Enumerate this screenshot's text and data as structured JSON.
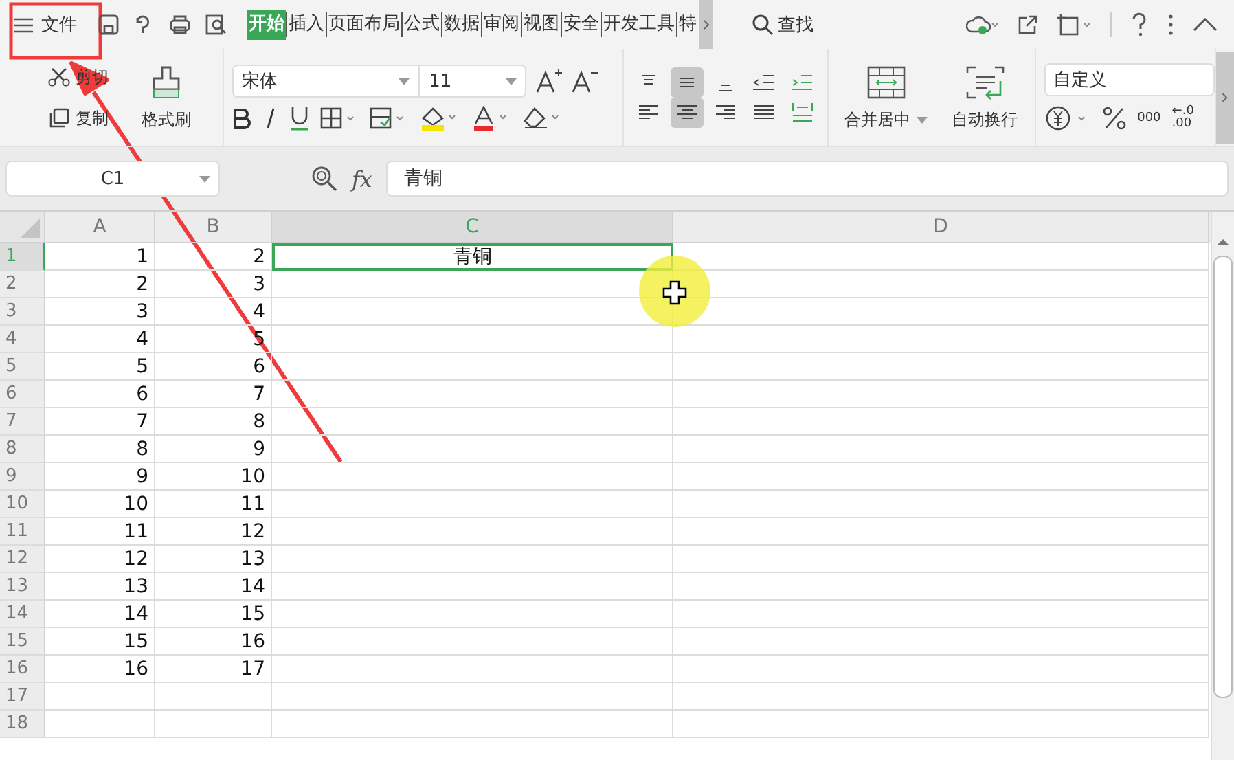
{
  "menu": {
    "label": "文件"
  },
  "tabs": [
    {
      "label": "开始",
      "selected": true
    },
    {
      "label": "插入",
      "selected": false
    },
    {
      "label": "页面布局",
      "selected": false
    },
    {
      "label": "公式",
      "selected": false
    },
    {
      "label": "数据",
      "selected": false
    },
    {
      "label": "审阅",
      "selected": false
    },
    {
      "label": "视图",
      "selected": false
    },
    {
      "label": "安全",
      "selected": false
    },
    {
      "label": "开发工具",
      "selected": false
    },
    {
      "label": "特",
      "selected": false
    }
  ],
  "search": {
    "label": "查找"
  },
  "clipboard": {
    "cut": "剪切",
    "copy": "复制",
    "format_painter": "格式刷"
  },
  "font": {
    "family": "宋体",
    "size": "11"
  },
  "merge": {
    "label": "合并居中"
  },
  "wrap": {
    "label": "自动换行"
  },
  "number_format": {
    "value": "自定义",
    "thousands": "000",
    "decimal_top": "←.0",
    "decimal_bottom": ".00"
  },
  "align": {
    "top_selected": false,
    "middle_selected": true,
    "center_selected": true
  },
  "formula_bar": {
    "name_box": "C1",
    "fx": "fx",
    "value": "青铜"
  },
  "sheet": {
    "columns": [
      {
        "label": "A",
        "selected": false
      },
      {
        "label": "B",
        "selected": false
      },
      {
        "label": "C",
        "selected": true
      },
      {
        "label": "D",
        "selected": false
      }
    ],
    "rows": [
      {
        "label": "1",
        "selected": true,
        "cells": [
          "1",
          "2",
          "青铜"
        ]
      },
      {
        "label": "2",
        "selected": false,
        "cells": [
          "2",
          "3",
          ""
        ]
      },
      {
        "label": "3",
        "selected": false,
        "cells": [
          "3",
          "4",
          ""
        ]
      },
      {
        "label": "4",
        "selected": false,
        "cells": [
          "4",
          "5",
          ""
        ]
      },
      {
        "label": "5",
        "selected": false,
        "cells": [
          "5",
          "6",
          ""
        ]
      },
      {
        "label": "6",
        "selected": false,
        "cells": [
          "6",
          "7",
          ""
        ]
      },
      {
        "label": "7",
        "selected": false,
        "cells": [
          "7",
          "8",
          ""
        ]
      },
      {
        "label": "8",
        "selected": false,
        "cells": [
          "8",
          "9",
          ""
        ]
      },
      {
        "label": "9",
        "selected": false,
        "cells": [
          "9",
          "10",
          ""
        ]
      },
      {
        "label": "10",
        "selected": false,
        "cells": [
          "10",
          "11",
          ""
        ]
      },
      {
        "label": "11",
        "selected": false,
        "cells": [
          "11",
          "12",
          ""
        ]
      },
      {
        "label": "12",
        "selected": false,
        "cells": [
          "12",
          "13",
          ""
        ]
      },
      {
        "label": "13",
        "selected": false,
        "cells": [
          "13",
          "14",
          ""
        ]
      },
      {
        "label": "14",
        "selected": false,
        "cells": [
          "14",
          "15",
          ""
        ]
      },
      {
        "label": "15",
        "selected": false,
        "cells": [
          "15",
          "16",
          ""
        ]
      },
      {
        "label": "16",
        "selected": false,
        "cells": [
          "16",
          "17",
          ""
        ]
      },
      {
        "label": "17",
        "selected": false,
        "cells": [
          "",
          "",
          ""
        ]
      },
      {
        "label": "18",
        "selected": false,
        "cells": [
          "",
          "",
          ""
        ]
      }
    ]
  }
}
